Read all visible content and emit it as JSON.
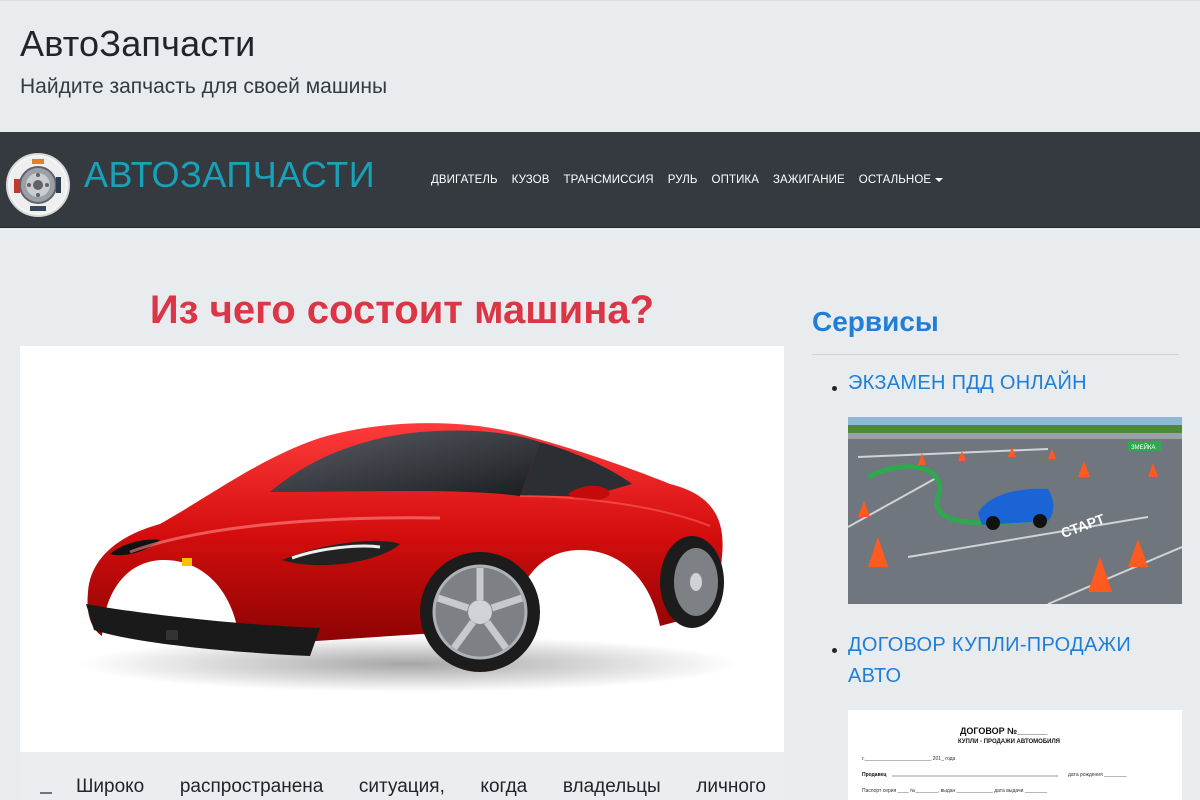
{
  "header": {
    "title": "АвтоЗапчасти",
    "subtitle": "Найдите запчасть для своей машины"
  },
  "navbar": {
    "brand": "АВТОЗАПЧАСТИ",
    "items": [
      {
        "label": "ДВИГАТЕЛЬ"
      },
      {
        "label": "КУЗОВ"
      },
      {
        "label": "ТРАНСМИССИЯ"
      },
      {
        "label": "РУЛЬ"
      },
      {
        "label": "ОПТИКА"
      },
      {
        "label": "ЗАЖИГАНИЕ"
      },
      {
        "label": "ОСТАЛЬНОЕ",
        "dropdown": true
      }
    ]
  },
  "article": {
    "title": "Из чего состоит машина?",
    "image_alt": "red sports car",
    "text": "Широко распространена ситуация, когда владельцы личного"
  },
  "sidebar": {
    "title": "Сервисы",
    "links": [
      {
        "label": "ЭКЗАМЕН ПДД ОНЛАЙН"
      },
      {
        "label_line1": "ДОГОВОР КУПЛИ-ПРОДАЖИ",
        "label_line2": "АВТО"
      }
    ],
    "exam_sign": "ЗМЕЙКА",
    "exam_ground": "СТАРТ",
    "contract": {
      "heading": "ДОГОВОР №______",
      "subheading": "КУПЛИ - ПРОДАЖИ АВТОМОБИЛЯ",
      "line1": "г.________________________          201_ года",
      "line2_left": "Продавец",
      "line2_right": "дата рождения ________",
      "line3": "Паспорт серия ____ №________, выдан _____________ дата выдачи ________"
    }
  },
  "colors": {
    "accent_blue": "#1e7ed8",
    "brand_teal": "#17a2b8",
    "title_red": "#dc3545",
    "navbar_bg": "#343a40",
    "page_bg": "#e9ecef"
  }
}
